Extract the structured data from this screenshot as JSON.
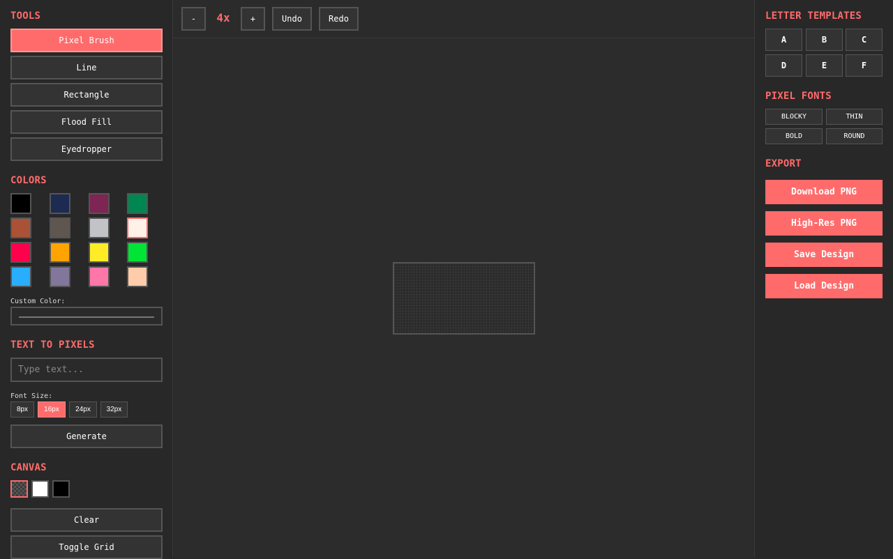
{
  "tools": {
    "heading": "TOOLS",
    "items": [
      {
        "label": "Pixel Brush",
        "active": true
      },
      {
        "label": "Line"
      },
      {
        "label": "Rectangle"
      },
      {
        "label": "Flood Fill"
      },
      {
        "label": "Eyedropper"
      }
    ]
  },
  "colors": {
    "heading": "COLORS",
    "palette": [
      "#000000",
      "#1d2b53",
      "#7e2553",
      "#008751",
      "#ab5236",
      "#5f574f",
      "#c2c3c7",
      "#fff1e8",
      "#ff004d",
      "#ffa300",
      "#ffec27",
      "#00e436",
      "#29adff",
      "#83769c",
      "#ff77a8",
      "#ffccaa"
    ],
    "selected": "#fff1e8",
    "custom_label": "Custom Color:"
  },
  "text_to_pixels": {
    "heading": "TEXT TO PIXELS",
    "placeholder": "Type text...",
    "font_size_label": "Font Size:",
    "sizes": [
      "8px",
      "16px",
      "24px",
      "32px"
    ],
    "selected_size": "16px",
    "generate_label": "Generate"
  },
  "canvas": {
    "heading": "CANVAS",
    "backgrounds": [
      "transparent",
      "white",
      "black"
    ],
    "clear_label": "Clear",
    "grid_label": "Toggle Grid"
  },
  "toolbar": {
    "zoom_out": "-",
    "zoom_level": "4x",
    "zoom_in": "+",
    "undo": "Undo",
    "redo": "Redo"
  },
  "templates": {
    "heading": "LETTER TEMPLATES",
    "letters": [
      "A",
      "B",
      "C",
      "D",
      "E",
      "F"
    ]
  },
  "fonts": {
    "heading": "PIXEL FONTS",
    "items": [
      "BLOCKY",
      "THIN",
      "BOLD",
      "ROUND"
    ]
  },
  "export": {
    "heading": "EXPORT",
    "download": "Download PNG",
    "highres": "High-Res PNG",
    "save": "Save Design",
    "load": "Load Design"
  }
}
